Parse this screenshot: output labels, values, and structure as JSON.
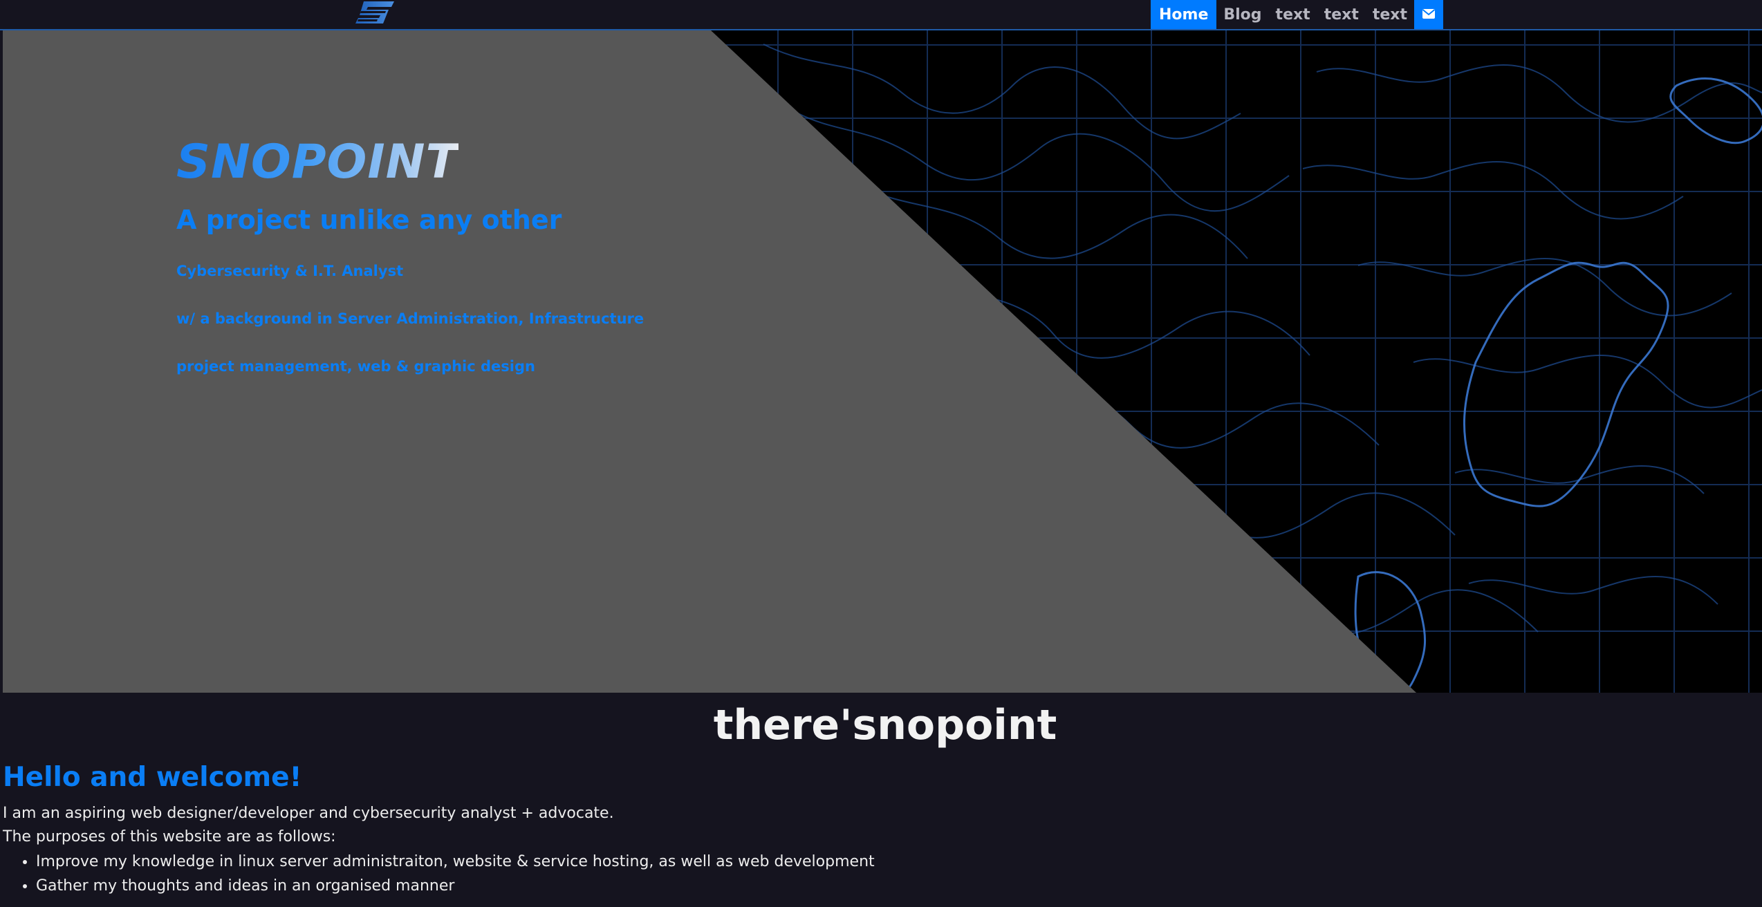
{
  "colors": {
    "accent": "#007bff",
    "link_blue": "#0a7ef5",
    "page_bg": "#15141f",
    "hero_gray": "#575757",
    "map_line": "#1e4f94"
  },
  "header": {
    "logo_icon": "snopoint-s-logo",
    "nav": [
      {
        "label": "Home",
        "active": true
      },
      {
        "label": "Blog"
      },
      {
        "label": "text"
      },
      {
        "label": "text"
      },
      {
        "label": "text"
      }
    ],
    "mail_icon": "envelope-icon"
  },
  "hero": {
    "title": "SNOPOINT",
    "tagline": "A project unlike any other",
    "lines": [
      "Cybersecurity & I.T. Analyst",
      "w/ a background in Server Administration, Infrastructure",
      "project management, web & graphic design"
    ]
  },
  "main": {
    "site_title": "there'snopoint",
    "heading": "Hello and welcome!",
    "intro": "I am an aspiring web designer/developer and cybersecurity analyst + advocate.",
    "purposes_intro": "The purposes of this website are as follows:",
    "purposes": [
      "Improve my knowledge in linux server administraiton, website & service hosting, as well as web development",
      "Gather my thoughts and ideas in an organised manner"
    ]
  }
}
